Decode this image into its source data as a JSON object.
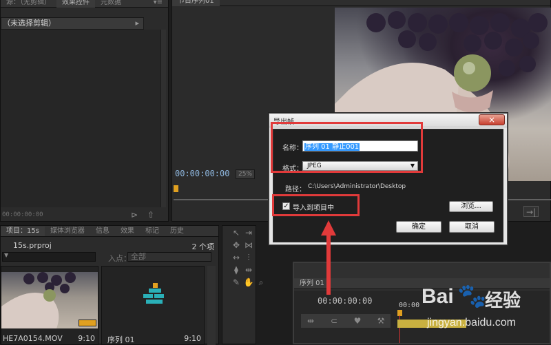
{
  "source_monitor": {
    "tabs": [
      "源：（无剪辑）",
      "效果控件",
      "元数据"
    ],
    "clip_header": "（未选择剪辑）",
    "timecode": "00:00:00:00"
  },
  "program_monitor": {
    "tabs": [
      "节目序列01"
    ],
    "timecode": "00:00:00:00",
    "zoom": "25%"
  },
  "project_panel": {
    "tabs": [
      "项目：15s",
      "媒体浏览器",
      "信息",
      "效果",
      "标记",
      "历史"
    ],
    "project_file": "15s.prproj",
    "item_count": "2 个项",
    "in_point_label": "入点：",
    "in_point_value": "全部",
    "items": [
      {
        "name": "HE7A0154.MOV",
        "duration": "9:10"
      },
      {
        "name": "序列 01",
        "duration": "9:10"
      }
    ]
  },
  "timeline": {
    "tabs": [
      "序列 01"
    ],
    "timecode": "00:00:00:00",
    "ruler_start": "00:00"
  },
  "dialog": {
    "title": "导出帧",
    "name_label": "名称：",
    "name_value": "序列 01 静止001",
    "format_label": "格式：",
    "format_value": "JPEG",
    "path_label": "路径：",
    "path_value": "C:\\Users\\Administrator\\Desktop",
    "import_label": "导入到项目中",
    "import_checked": true,
    "browse_label": "浏览...",
    "ok_label": "确定",
    "cancel_label": "取消",
    "close_glyph": "×"
  },
  "watermark": {
    "brand_text": "Bai",
    "brand_text2": "经验",
    "url": "jingyan.baidu.com"
  },
  "colors": {
    "highlight_red": "#e13a3a",
    "playhead": "#e0a020",
    "selection_blue": "#3399ff"
  }
}
